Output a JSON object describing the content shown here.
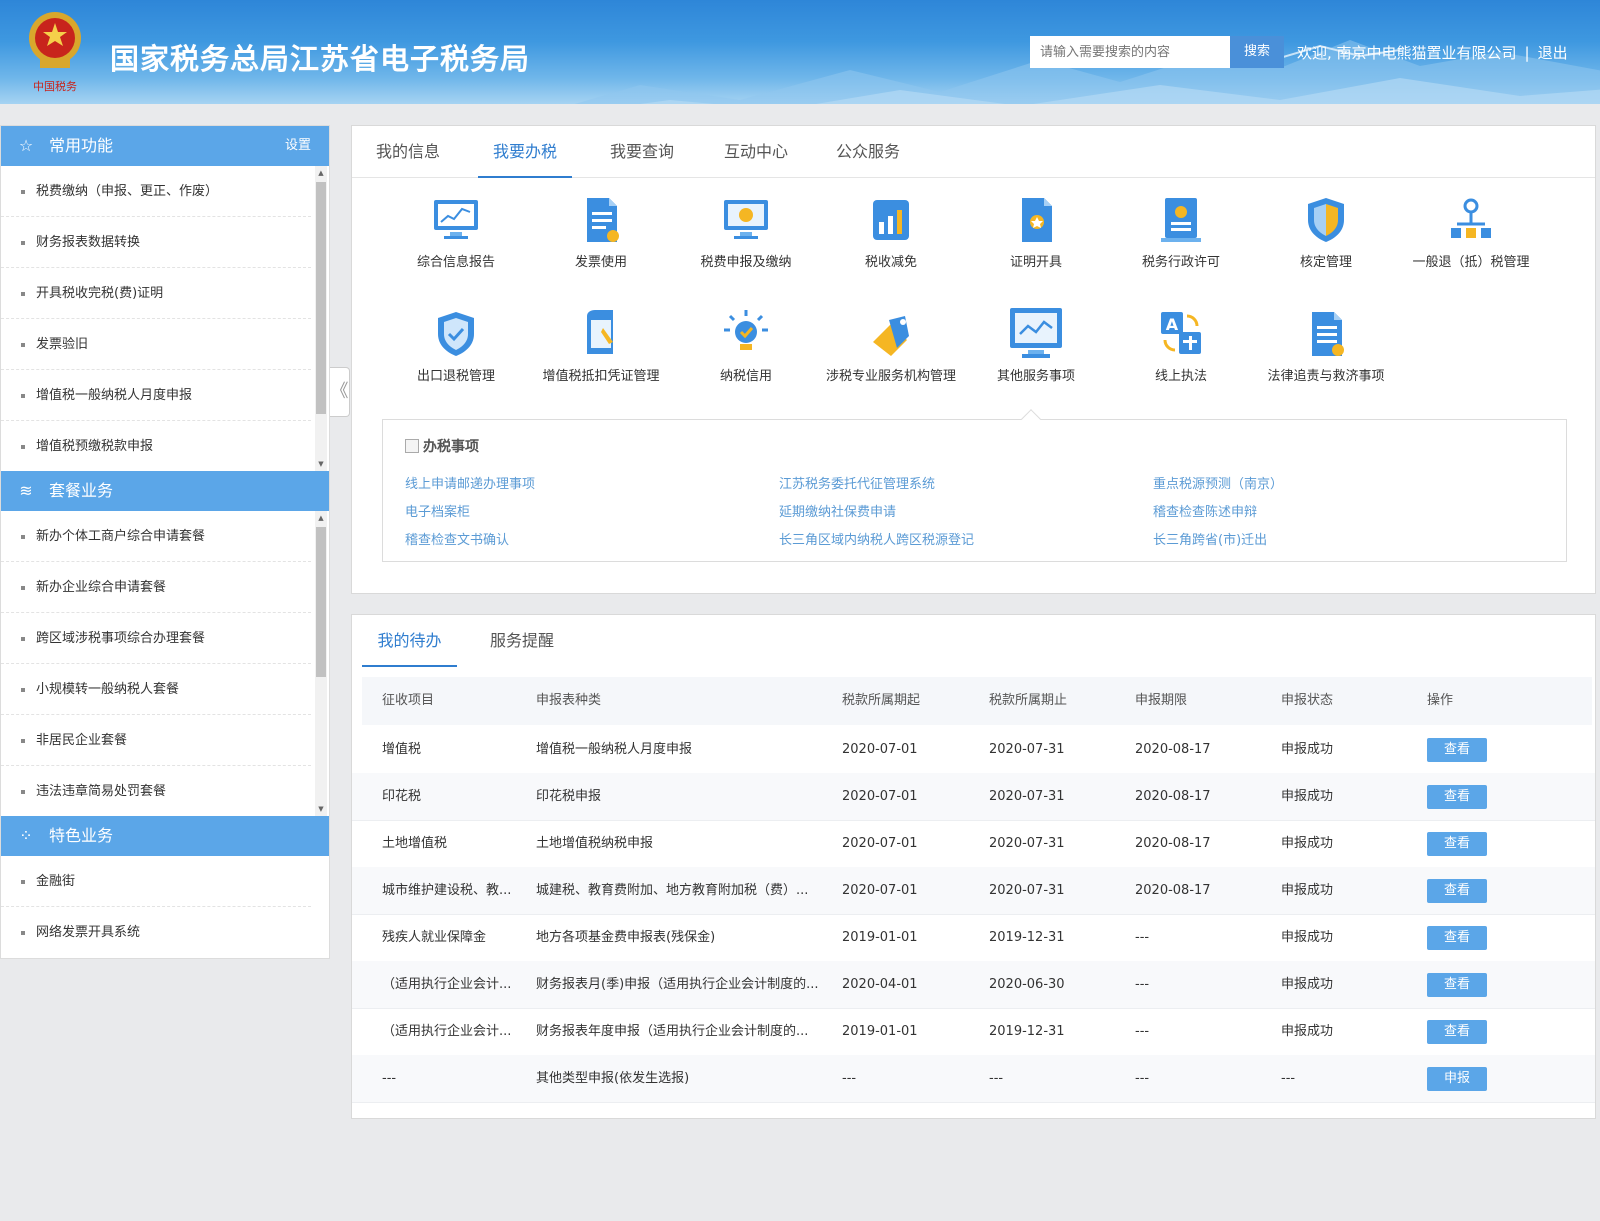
{
  "header": {
    "title": "国家税务总局江苏省电子税务局",
    "search_placeholder": "请输入需要搜索的内容",
    "search_button": "搜索",
    "welcome": "欢迎, 南京中电熊猫置业有限公司",
    "separator": "|",
    "logout": "退出",
    "logo_caption": "中国税务"
  },
  "sidebar": {
    "sections": [
      {
        "title": "常用功能",
        "action": "设置",
        "icon": "star-icon",
        "items": [
          "税费缴纳（申报、更正、作废）",
          "财务报表数据转换",
          "开具税收完税(费)证明",
          "发票验旧",
          "增值税一般纳税人月度申报",
          "增值税预缴税款申报"
        ]
      },
      {
        "title": "套餐业务",
        "icon": "layers-icon",
        "items": [
          "新办个体工商户综合申请套餐",
          "新办企业综合申请套餐",
          "跨区域涉税事项综合办理套餐",
          "小规模转一般纳税人套餐",
          "非居民企业套餐",
          "违法违章简易处罚套餐"
        ]
      },
      {
        "title": "特色业务",
        "icon": "grid-icon",
        "items": [
          "金融街",
          "网络发票开具系统"
        ]
      }
    ],
    "collapse_label": "《"
  },
  "main": {
    "tabs": [
      "我的信息",
      "我要办税",
      "我要查询",
      "互动中心",
      "公众服务"
    ],
    "active_tab": "我要办税",
    "functions": [
      {
        "label": "综合信息报告",
        "icon": "monitor-chart-icon"
      },
      {
        "label": "发票使用",
        "icon": "invoice-icon"
      },
      {
        "label": "税费申报及缴纳",
        "icon": "monitor-coin-icon"
      },
      {
        "label": "税收减免",
        "icon": "bar-chart-icon"
      },
      {
        "label": "证明开具",
        "icon": "certificate-icon"
      },
      {
        "label": "税务行政许可",
        "icon": "license-icon"
      },
      {
        "label": "核定管理",
        "icon": "shield-icon"
      },
      {
        "label": "一般退（抵）税管理",
        "icon": "tree-icon"
      },
      {
        "label": "出口退税管理",
        "icon": "shield-check-icon"
      },
      {
        "label": "增值税抵扣凭证管理",
        "icon": "document-pen-icon"
      },
      {
        "label": "纳税信用",
        "icon": "bulb-icon"
      },
      {
        "label": "涉税专业服务机构管理",
        "icon": "tag-icon"
      },
      {
        "label": "其他服务事项",
        "icon": "monitor-wave-icon"
      },
      {
        "label": "线上执法",
        "icon": "translate-icon"
      },
      {
        "label": "法律追责与救济事项",
        "icon": "doc-list-icon"
      }
    ],
    "sub_section": {
      "title": "办税事项",
      "links": [
        "线上申请邮递办理事项",
        "江苏税务委托代征管理系统",
        "重点税源预测（南京）",
        "电子档案柜",
        "延期缴纳社保费申请",
        "稽查检查陈述申辩",
        "稽查检查文书确认",
        "长三角区域内纳税人跨区税源登记",
        "长三角跨省(市)迁出"
      ]
    }
  },
  "todo": {
    "tabs": [
      "我的待办",
      "服务提醒"
    ],
    "active_tab": "我的待办",
    "columns": [
      "征收项目",
      "申报表种类",
      "税款所属期起",
      "税款所属期止",
      "申报期限",
      "申报状态",
      "操作"
    ],
    "rows": [
      [
        "增值税",
        "增值税一般纳税人月度申报",
        "2020-07-01",
        "2020-07-31",
        "2020-08-17",
        "申报成功",
        "查看"
      ],
      [
        "印花税",
        "印花税申报",
        "2020-07-01",
        "2020-07-31",
        "2020-08-17",
        "申报成功",
        "查看"
      ],
      [
        "土地增值税",
        "土地增值税纳税申报",
        "2020-07-01",
        "2020-07-31",
        "2020-08-17",
        "申报成功",
        "查看"
      ],
      [
        "城市维护建设税、教...",
        "城建税、教育费附加、地方教育附加税（费）...",
        "2020-07-01",
        "2020-07-31",
        "2020-08-17",
        "申报成功",
        "查看"
      ],
      [
        "残疾人就业保障金",
        "地方各项基金费申报表(残保金)",
        "2019-01-01",
        "2019-12-31",
        "---",
        "申报成功",
        "查看"
      ],
      [
        "（适用执行企业会计...",
        "财务报表月(季)申报（适用执行企业会计制度的...",
        "2020-04-01",
        "2020-06-30",
        "---",
        "申报成功",
        "查看"
      ],
      [
        "（适用执行企业会计...",
        "财务报表年度申报（适用执行企业会计制度的...",
        "2019-01-01",
        "2019-12-31",
        "---",
        "申报成功",
        "查看"
      ],
      [
        "---",
        "其他类型申报(依发生选报)",
        "---",
        "---",
        "---",
        "---",
        "申报"
      ]
    ]
  },
  "colors": {
    "accent": "#2f7dcf",
    "sidebar_head": "#5ba6e8",
    "link": "#5b9bd5",
    "button": "#5ba6e8"
  }
}
